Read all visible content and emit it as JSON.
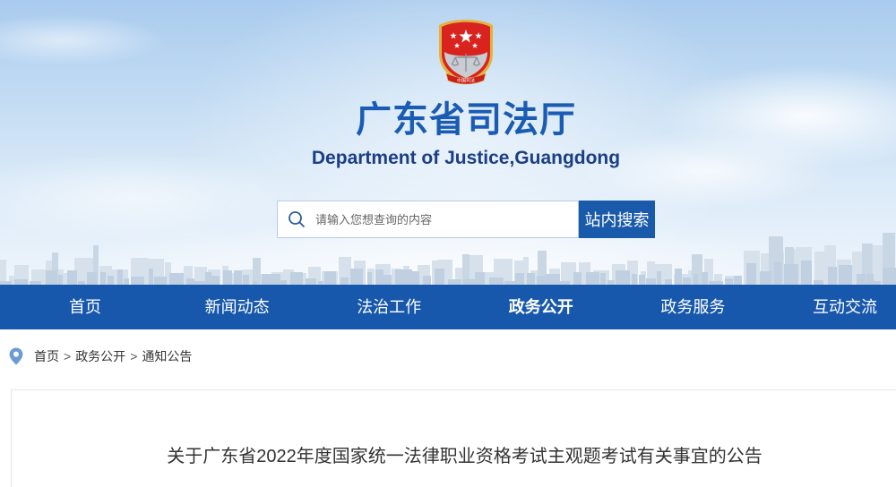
{
  "colors": {
    "primary": "#1758ad",
    "title": "#1a5cb4",
    "subtitle": "#1c3e86",
    "emblem_red": "#d8231f",
    "emblem_gold": "#e3b23c"
  },
  "header": {
    "emblem_icon": "justice-emblem",
    "emblem_text": "中国司法",
    "title": "广东省司法厅",
    "subtitle": "Department of Justice,Guangdong",
    "search": {
      "icon": "search-icon",
      "placeholder": "请输入您想查询的内容",
      "value": "",
      "button_label": "站内搜索"
    }
  },
  "nav": {
    "items": [
      {
        "label": "首页",
        "active": false
      },
      {
        "label": "新闻动态",
        "active": false
      },
      {
        "label": "法治工作",
        "active": false
      },
      {
        "label": "政务公开",
        "active": true
      },
      {
        "label": "政务服务",
        "active": false
      },
      {
        "label": "互动交流",
        "active": false
      }
    ]
  },
  "breadcrumb": {
    "icon": "location-pin-icon",
    "separator": ">",
    "items": [
      "首页",
      "政务公开",
      "通知公告"
    ]
  },
  "article": {
    "title": "关于广东省2022年度国家统一法律职业资格考试主观题考试有关事宜的公告"
  }
}
